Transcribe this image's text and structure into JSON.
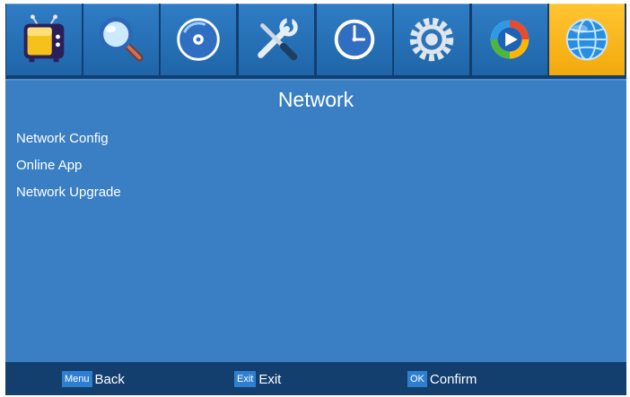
{
  "tabs": [
    {
      "icon": "tv-icon",
      "selected": false
    },
    {
      "icon": "search-icon",
      "selected": false
    },
    {
      "icon": "disc-icon",
      "selected": false
    },
    {
      "icon": "tools-icon",
      "selected": false
    },
    {
      "icon": "clock-icon",
      "selected": false
    },
    {
      "icon": "gear-icon",
      "selected": false
    },
    {
      "icon": "media-player-icon",
      "selected": false
    },
    {
      "icon": "globe-icon",
      "selected": true
    }
  ],
  "page": {
    "title": "Network"
  },
  "menu": {
    "items": [
      {
        "label": "Network Config"
      },
      {
        "label": "Online App"
      },
      {
        "label": "Network Upgrade"
      }
    ]
  },
  "footer": {
    "back": {
      "key": "Menu",
      "label": "Back"
    },
    "exit": {
      "key": "Exit",
      "label": "Exit"
    },
    "confirm": {
      "key": "OK",
      "label": "Confirm"
    }
  },
  "colors": {
    "tab_normal": "#2a74bd",
    "tab_selected": "#fbb81e",
    "panel": "#3a7fc3",
    "footer": "#133f6e",
    "key_badge": "#2f7fd0"
  }
}
